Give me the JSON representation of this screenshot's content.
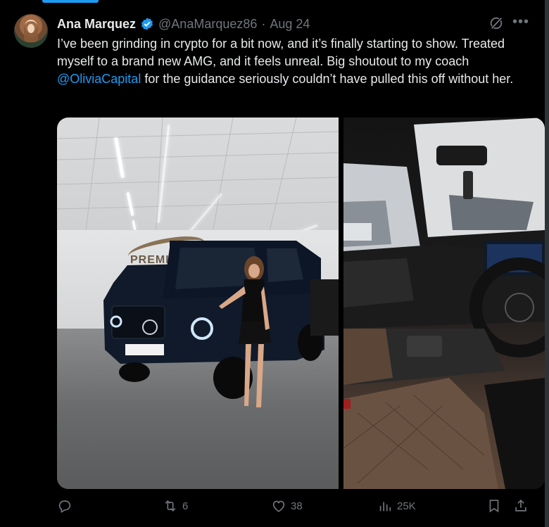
{
  "tweet": {
    "author_name": "Ana Marquez",
    "handle": "@AnaMarquez86",
    "separator": "·",
    "date": "Aug 24",
    "text_before": "I’ve been grinding in crypto for a bit now, and it’s finally starting to show. Treated myself to a brand new AMG, and it feels unreal. Big shoutout to my coach ",
    "mention": "@OliviaCapital",
    "text_after": " for the guidance seriously couldn’t have pulled this off without her.",
    "sign_text": "PREMIER CA"
  },
  "actions": {
    "reply_count": "",
    "retweet_count": "6",
    "like_count": "38",
    "views_count": "25K"
  },
  "colors": {
    "background": "#000000",
    "text": "#e7e9ea",
    "muted": "#71767b",
    "accent": "#1d9bf0"
  },
  "icons": [
    "verified-badge-icon",
    "grok-icon",
    "more-icon",
    "reply-icon",
    "retweet-icon",
    "like-icon",
    "views-icon",
    "bookmark-icon",
    "share-icon"
  ]
}
